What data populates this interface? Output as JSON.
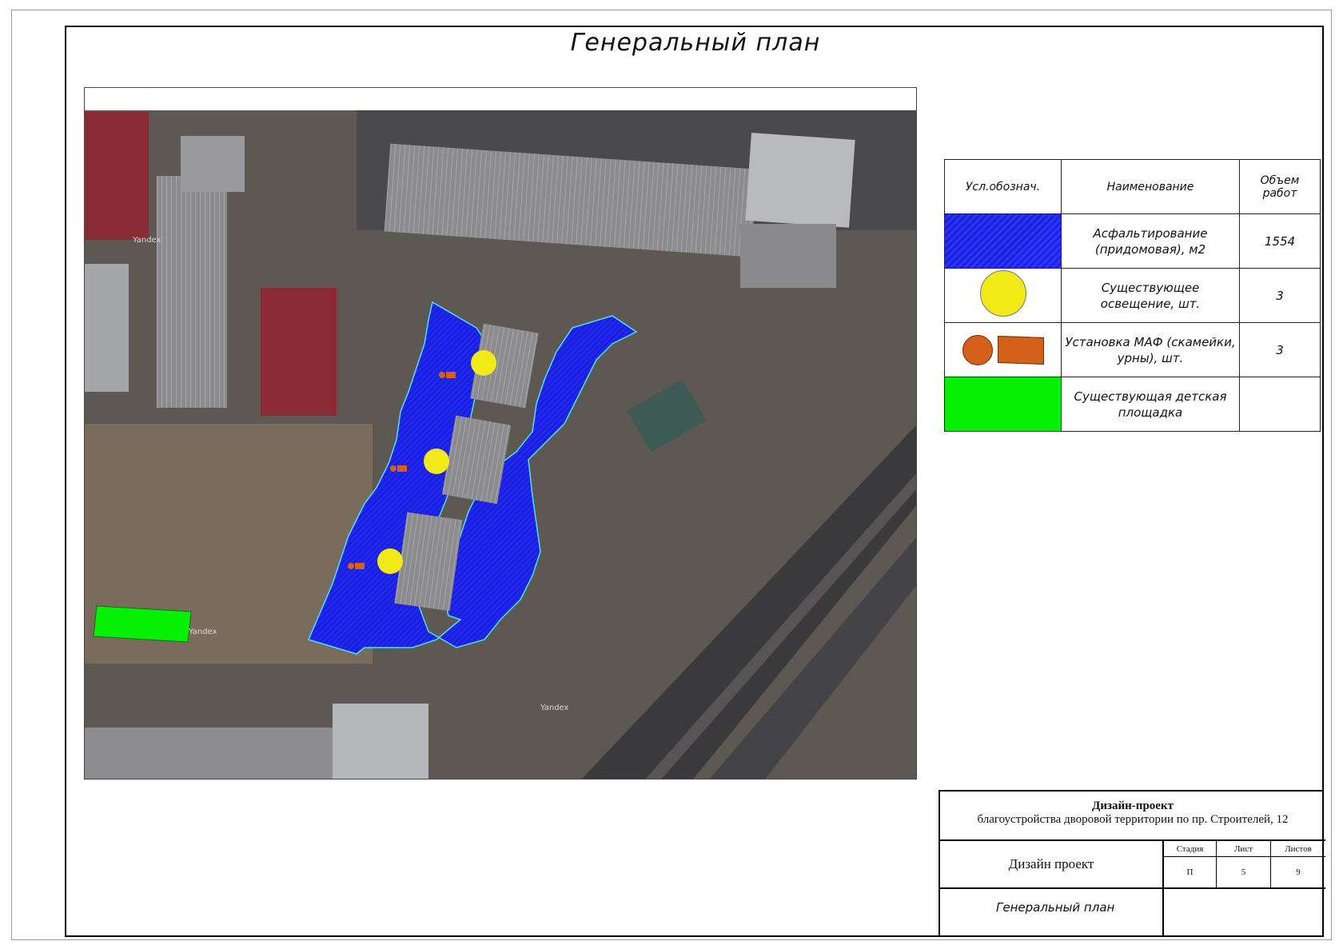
{
  "sheet": {
    "title": "Генеральный план"
  },
  "map": {
    "watermarks": [
      "Yandex",
      "Yandex",
      "Yandex"
    ]
  },
  "legend": {
    "headers": {
      "symbol": "Усл.обознач.",
      "name": "Наименование",
      "volume": "Объем работ"
    },
    "rows": [
      {
        "symbol": "blue-hatch-swatch",
        "name": "Асфальтирование (придомовая), м2",
        "volume": "1554"
      },
      {
        "symbol": "yellow-circle",
        "name": "Существующее освещение, шт.",
        "volume": "3"
      },
      {
        "symbol": "orange-circle-and-rectangle",
        "name": "Установка МАФ (скамейки, урны), шт.",
        "volume": "3"
      },
      {
        "symbol": "green-swatch",
        "name": "Существующая детская площадка",
        "volume": ""
      }
    ]
  },
  "stamp": {
    "project_title": "Дизайн-проект",
    "project_subtitle": "благоустройства дворовой территории по пр. Строителей, 12",
    "doc_type": "Дизайн проект",
    "stage_label": "Стадия",
    "sheet_label": "Лист",
    "sheets_label": "Листов",
    "stage_value": "П",
    "sheet_value": "5",
    "sheets_value": "9",
    "drawing_name": "Генеральный план"
  },
  "colors": {
    "asphalt": "#1d22d9",
    "lighting": "#f2ea17",
    "maf": "#d4601a",
    "playground": "#06f006"
  }
}
